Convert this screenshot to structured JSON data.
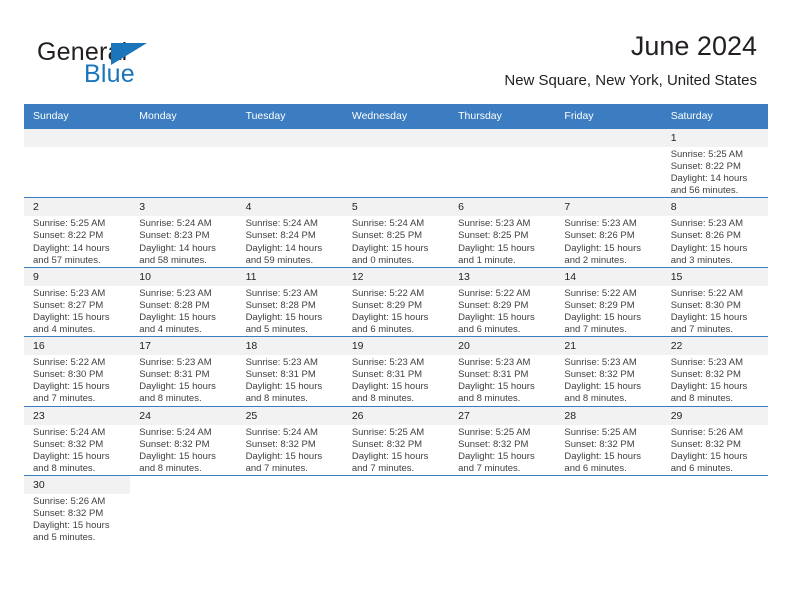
{
  "brand": {
    "name_part1": "General",
    "name_part2": "Blue",
    "logo_icon": "triangle-sail-icon"
  },
  "header": {
    "month_title": "June 2024",
    "location": "New Square, New York, United States"
  },
  "colors": {
    "header_row_bg": "#3b7dc0",
    "daynum_bg": "#f2f2f2",
    "brand_blue": "#1b75bb",
    "text": "#231f20",
    "info_text": "#414042"
  },
  "weekdays": [
    "Sunday",
    "Monday",
    "Tuesday",
    "Wednesday",
    "Thursday",
    "Friday",
    "Saturday"
  ],
  "labels": {
    "sunrise_prefix": "Sunrise: ",
    "sunset_prefix": "Sunset: ",
    "daylight_prefix": "Daylight: "
  },
  "weeks": [
    [
      {
        "empty": true
      },
      {
        "empty": true
      },
      {
        "empty": true
      },
      {
        "empty": true
      },
      {
        "empty": true
      },
      {
        "empty": true
      },
      {
        "day": "1",
        "sunrise": "Sunrise: 5:25 AM",
        "sunset": "Sunset: 8:22 PM",
        "daylight": "Daylight: 14 hours and 56 minutes."
      }
    ],
    [
      {
        "day": "2",
        "sunrise": "Sunrise: 5:25 AM",
        "sunset": "Sunset: 8:22 PM",
        "daylight": "Daylight: 14 hours and 57 minutes."
      },
      {
        "day": "3",
        "sunrise": "Sunrise: 5:24 AM",
        "sunset": "Sunset: 8:23 PM",
        "daylight": "Daylight: 14 hours and 58 minutes."
      },
      {
        "day": "4",
        "sunrise": "Sunrise: 5:24 AM",
        "sunset": "Sunset: 8:24 PM",
        "daylight": "Daylight: 14 hours and 59 minutes."
      },
      {
        "day": "5",
        "sunrise": "Sunrise: 5:24 AM",
        "sunset": "Sunset: 8:25 PM",
        "daylight": "Daylight: 15 hours and 0 minutes."
      },
      {
        "day": "6",
        "sunrise": "Sunrise: 5:23 AM",
        "sunset": "Sunset: 8:25 PM",
        "daylight": "Daylight: 15 hours and 1 minute."
      },
      {
        "day": "7",
        "sunrise": "Sunrise: 5:23 AM",
        "sunset": "Sunset: 8:26 PM",
        "daylight": "Daylight: 15 hours and 2 minutes."
      },
      {
        "day": "8",
        "sunrise": "Sunrise: 5:23 AM",
        "sunset": "Sunset: 8:26 PM",
        "daylight": "Daylight: 15 hours and 3 minutes."
      }
    ],
    [
      {
        "day": "9",
        "sunrise": "Sunrise: 5:23 AM",
        "sunset": "Sunset: 8:27 PM",
        "daylight": "Daylight: 15 hours and 4 minutes."
      },
      {
        "day": "10",
        "sunrise": "Sunrise: 5:23 AM",
        "sunset": "Sunset: 8:28 PM",
        "daylight": "Daylight: 15 hours and 4 minutes."
      },
      {
        "day": "11",
        "sunrise": "Sunrise: 5:23 AM",
        "sunset": "Sunset: 8:28 PM",
        "daylight": "Daylight: 15 hours and 5 minutes."
      },
      {
        "day": "12",
        "sunrise": "Sunrise: 5:22 AM",
        "sunset": "Sunset: 8:29 PM",
        "daylight": "Daylight: 15 hours and 6 minutes."
      },
      {
        "day": "13",
        "sunrise": "Sunrise: 5:22 AM",
        "sunset": "Sunset: 8:29 PM",
        "daylight": "Daylight: 15 hours and 6 minutes."
      },
      {
        "day": "14",
        "sunrise": "Sunrise: 5:22 AM",
        "sunset": "Sunset: 8:29 PM",
        "daylight": "Daylight: 15 hours and 7 minutes."
      },
      {
        "day": "15",
        "sunrise": "Sunrise: 5:22 AM",
        "sunset": "Sunset: 8:30 PM",
        "daylight": "Daylight: 15 hours and 7 minutes."
      }
    ],
    [
      {
        "day": "16",
        "sunrise": "Sunrise: 5:22 AM",
        "sunset": "Sunset: 8:30 PM",
        "daylight": "Daylight: 15 hours and 7 minutes."
      },
      {
        "day": "17",
        "sunrise": "Sunrise: 5:23 AM",
        "sunset": "Sunset: 8:31 PM",
        "daylight": "Daylight: 15 hours and 8 minutes."
      },
      {
        "day": "18",
        "sunrise": "Sunrise: 5:23 AM",
        "sunset": "Sunset: 8:31 PM",
        "daylight": "Daylight: 15 hours and 8 minutes."
      },
      {
        "day": "19",
        "sunrise": "Sunrise: 5:23 AM",
        "sunset": "Sunset: 8:31 PM",
        "daylight": "Daylight: 15 hours and 8 minutes."
      },
      {
        "day": "20",
        "sunrise": "Sunrise: 5:23 AM",
        "sunset": "Sunset: 8:31 PM",
        "daylight": "Daylight: 15 hours and 8 minutes."
      },
      {
        "day": "21",
        "sunrise": "Sunrise: 5:23 AM",
        "sunset": "Sunset: 8:32 PM",
        "daylight": "Daylight: 15 hours and 8 minutes."
      },
      {
        "day": "22",
        "sunrise": "Sunrise: 5:23 AM",
        "sunset": "Sunset: 8:32 PM",
        "daylight": "Daylight: 15 hours and 8 minutes."
      }
    ],
    [
      {
        "day": "23",
        "sunrise": "Sunrise: 5:24 AM",
        "sunset": "Sunset: 8:32 PM",
        "daylight": "Daylight: 15 hours and 8 minutes."
      },
      {
        "day": "24",
        "sunrise": "Sunrise: 5:24 AM",
        "sunset": "Sunset: 8:32 PM",
        "daylight": "Daylight: 15 hours and 8 minutes."
      },
      {
        "day": "25",
        "sunrise": "Sunrise: 5:24 AM",
        "sunset": "Sunset: 8:32 PM",
        "daylight": "Daylight: 15 hours and 7 minutes."
      },
      {
        "day": "26",
        "sunrise": "Sunrise: 5:25 AM",
        "sunset": "Sunset: 8:32 PM",
        "daylight": "Daylight: 15 hours and 7 minutes."
      },
      {
        "day": "27",
        "sunrise": "Sunrise: 5:25 AM",
        "sunset": "Sunset: 8:32 PM",
        "daylight": "Daylight: 15 hours and 7 minutes."
      },
      {
        "day": "28",
        "sunrise": "Sunrise: 5:25 AM",
        "sunset": "Sunset: 8:32 PM",
        "daylight": "Daylight: 15 hours and 6 minutes."
      },
      {
        "day": "29",
        "sunrise": "Sunrise: 5:26 AM",
        "sunset": "Sunset: 8:32 PM",
        "daylight": "Daylight: 15 hours and 6 minutes."
      }
    ],
    [
      {
        "day": "30",
        "sunrise": "Sunrise: 5:26 AM",
        "sunset": "Sunset: 8:32 PM",
        "daylight": "Daylight: 15 hours and 5 minutes."
      },
      {
        "blank": true
      },
      {
        "blank": true
      },
      {
        "blank": true
      },
      {
        "blank": true
      },
      {
        "blank": true
      },
      {
        "blank": true
      }
    ]
  ]
}
